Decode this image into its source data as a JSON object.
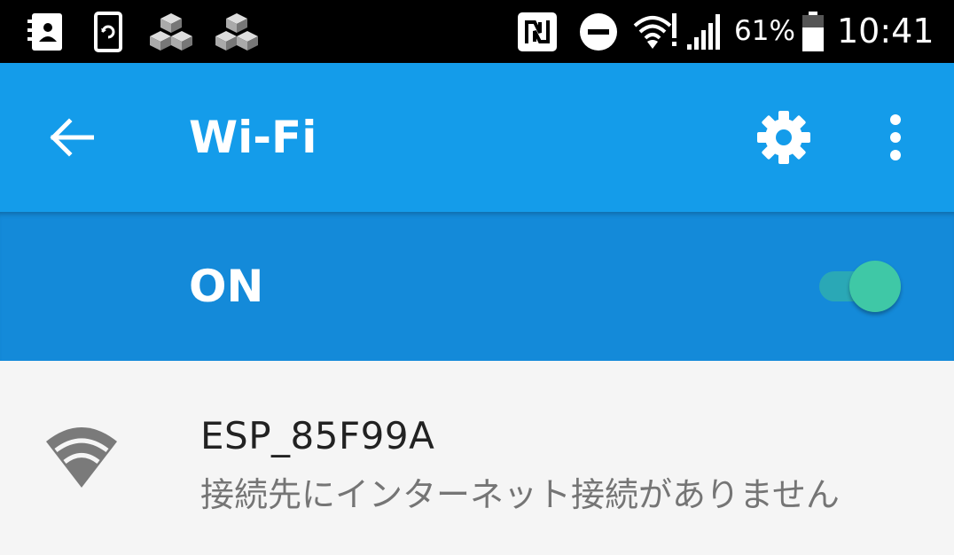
{
  "status_bar": {
    "battery_percent": "61%",
    "clock": "10:41",
    "icons": [
      "contacts-icon",
      "phone-sync-icon",
      "cubes-icon",
      "cubes-icon",
      "nfc-icon",
      "do-not-disturb-icon",
      "wifi-alert-icon",
      "cellular-signal-icon",
      "battery-icon"
    ]
  },
  "app_bar": {
    "title": "Wi-Fi",
    "back_icon": "arrow-back-icon",
    "settings_icon": "gear-icon",
    "overflow_icon": "more-vert-icon"
  },
  "switch_bar": {
    "label": "ON",
    "toggle_state": "on"
  },
  "networks": [
    {
      "ssid": "ESP_85F99A",
      "status": "接続先にインターネット接続がありません",
      "icon": "wifi-signal-icon"
    }
  ],
  "colors": {
    "status_bar_bg": "#000000",
    "app_bar_bg": "#149cea",
    "switch_bar_bg": "#148ad9",
    "toggle_thumb": "#3fc8a6",
    "list_bg": "#f5f5f5"
  }
}
